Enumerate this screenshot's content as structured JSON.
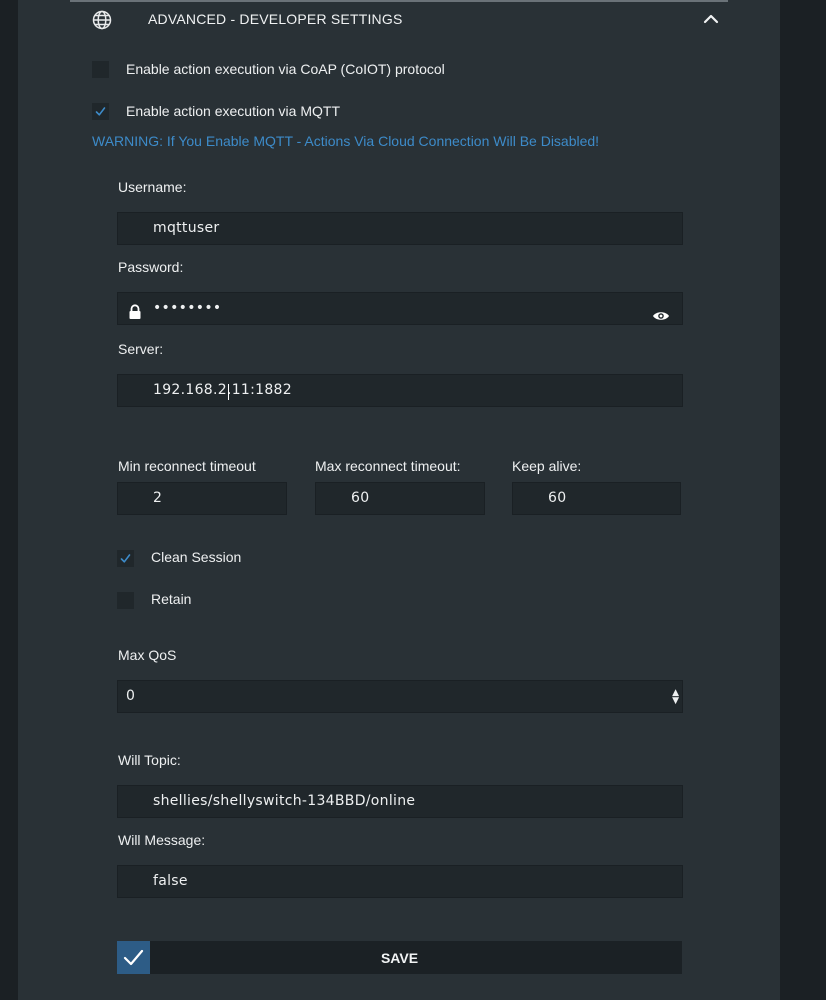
{
  "header": {
    "title": "ADVANCED - DEVELOPER SETTINGS",
    "icon": "globe-icon",
    "toggle_icon": "chevron-up-icon"
  },
  "options": {
    "coap": {
      "label": "Enable action execution via CoAP (CoIOT) protocol",
      "checked": false
    },
    "mqtt": {
      "label": "Enable action execution via MQTT",
      "checked": true
    }
  },
  "warning": "WARNING: If You Enable MQTT - Actions Via Cloud Connection Will Be Disabled!",
  "mqtt": {
    "username": {
      "label": "Username:",
      "value": "mqttuser"
    },
    "password": {
      "label": "Password:",
      "value": "••••••••"
    },
    "server": {
      "label": "Server:",
      "value": "192.168.2.11:1882"
    },
    "min_reconnect": {
      "label": "Min reconnect timeout",
      "value": "2"
    },
    "max_reconnect": {
      "label": "Max reconnect timeout:",
      "value": "60"
    },
    "keep_alive": {
      "label": "Keep alive:",
      "value": "60"
    },
    "clean_session": {
      "label": "Clean Session",
      "checked": true
    },
    "retain": {
      "label": "Retain",
      "checked": false
    },
    "max_qos": {
      "label": "Max QoS",
      "value": "0"
    },
    "will_topic": {
      "label": "Will Topic:",
      "value": "shellies/shellyswitch-134BBD/online"
    },
    "will_message": {
      "label": "Will Message:",
      "value": "false"
    }
  },
  "save": {
    "label": "SAVE"
  },
  "colors": {
    "accent": "#3d8bc9",
    "panel": "#293136",
    "field": "#20272b",
    "save_check": "#2d5c86"
  }
}
